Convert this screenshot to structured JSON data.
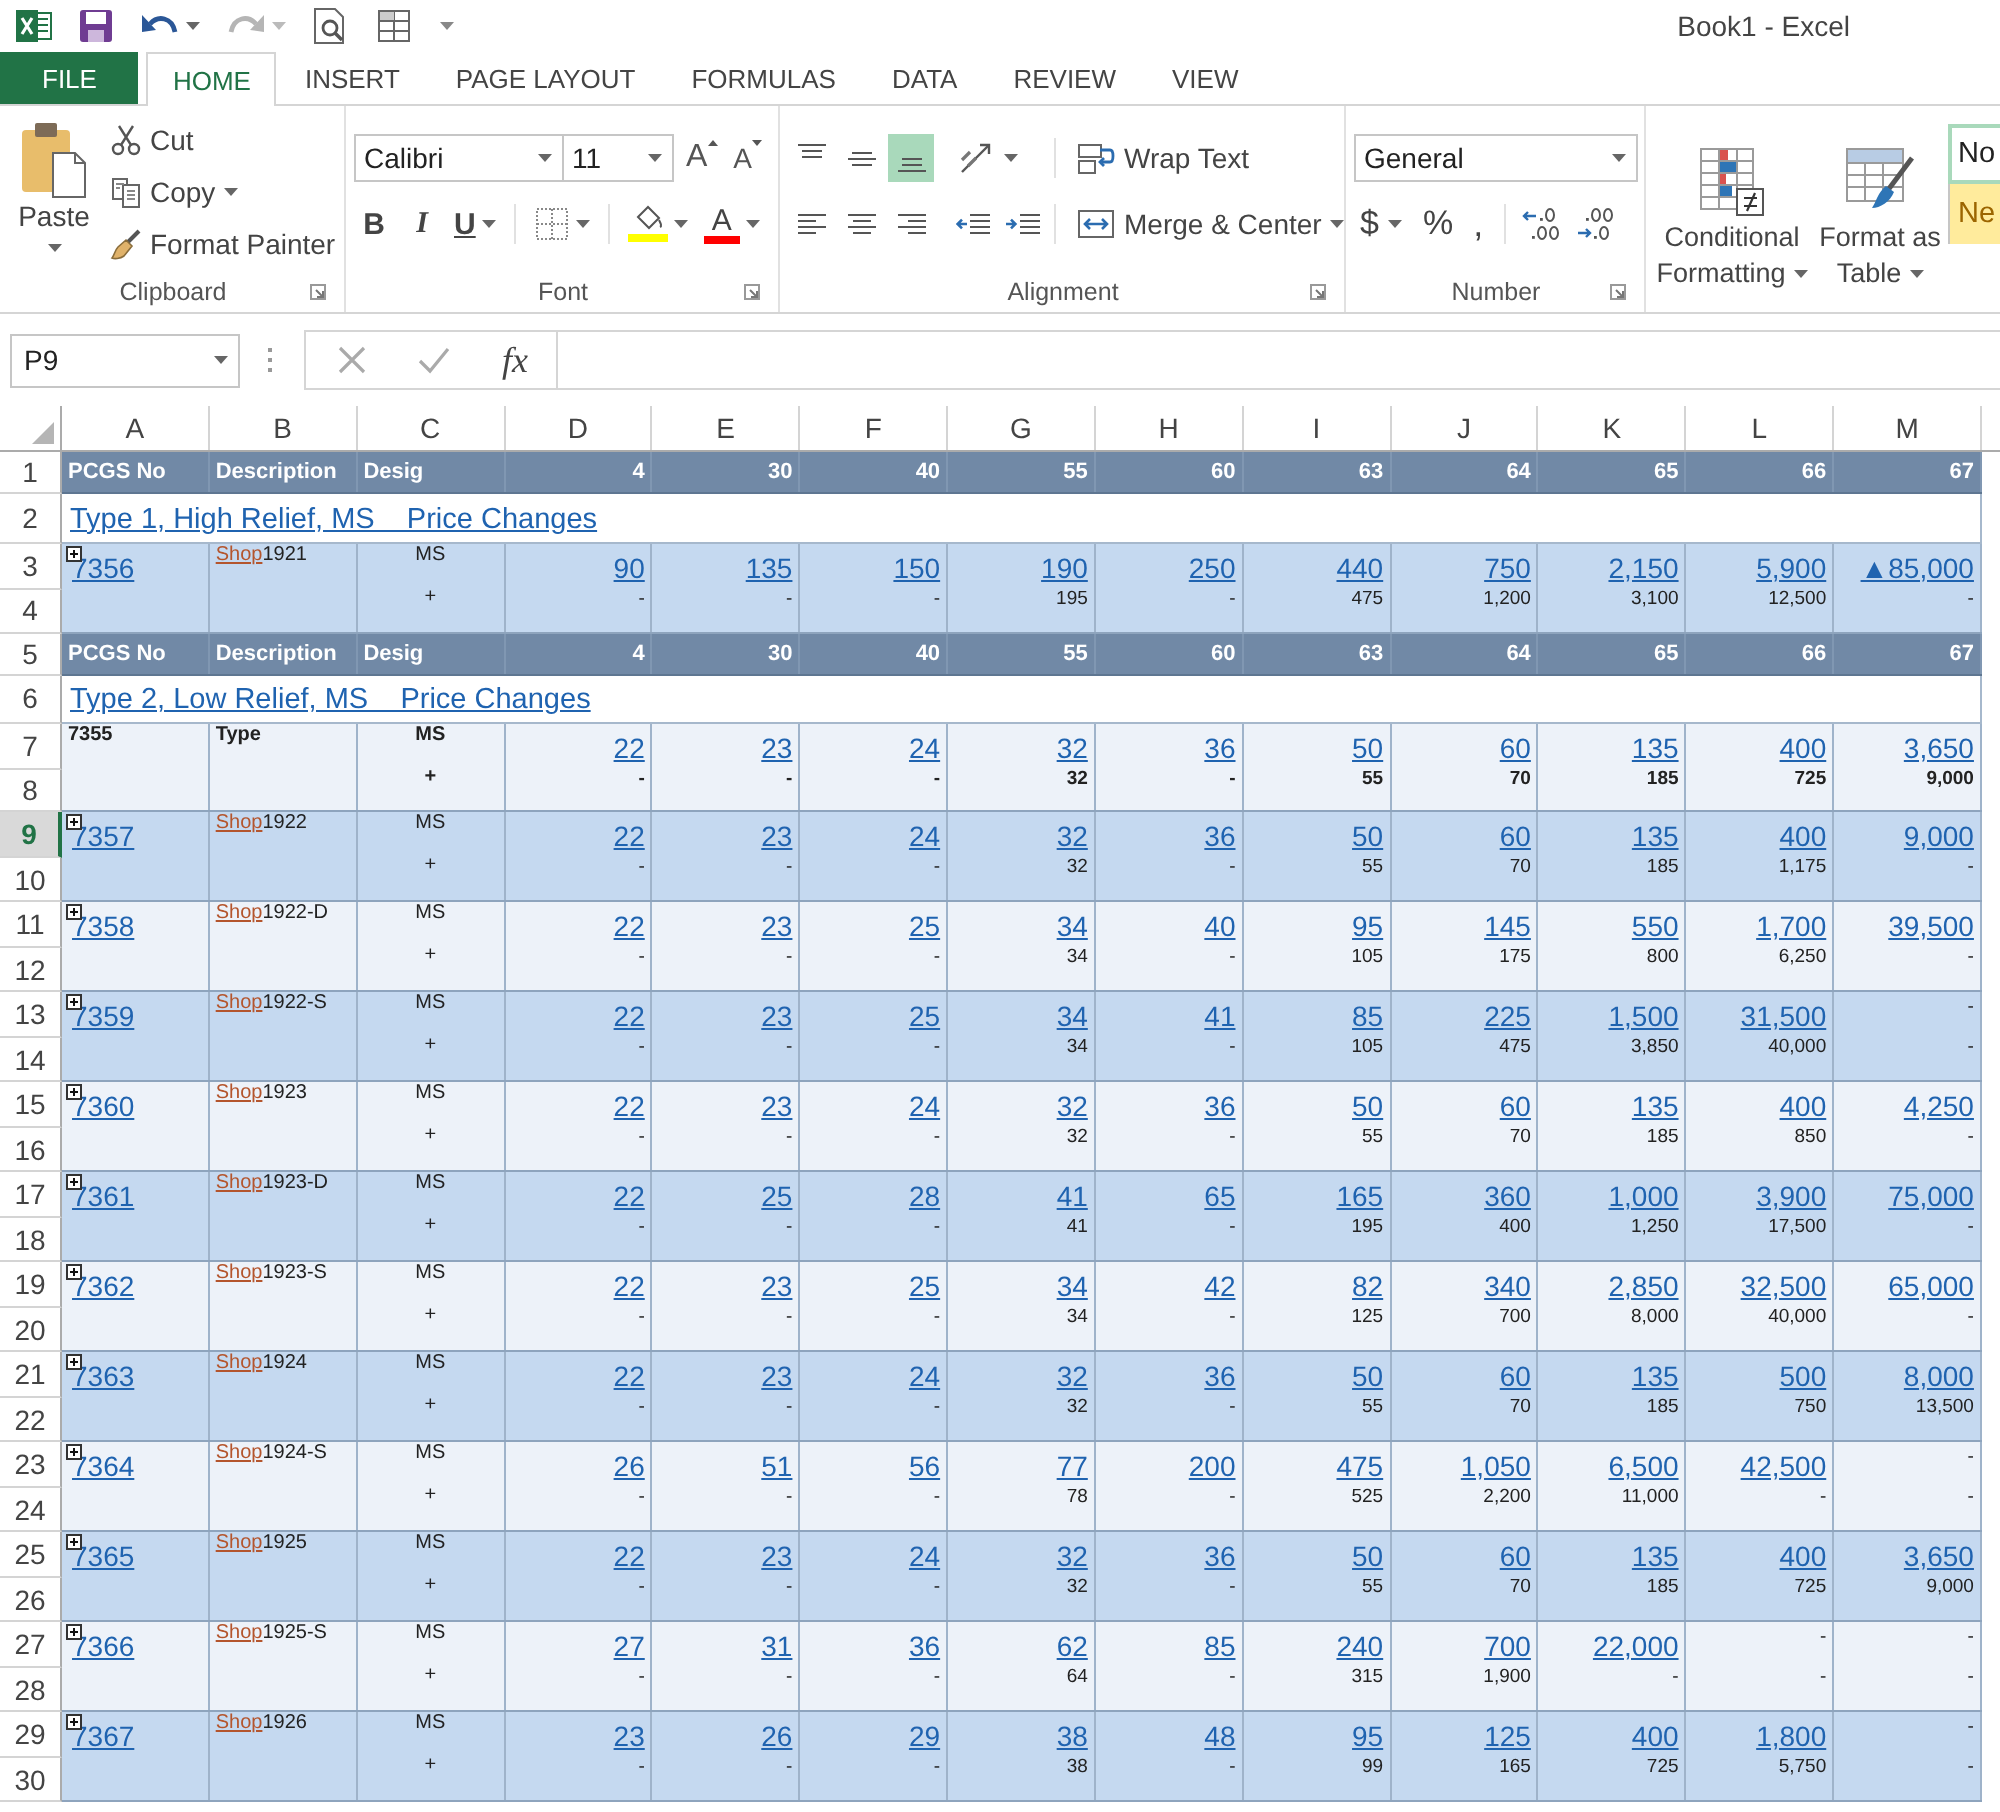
{
  "window": {
    "title": "Book1 - Excel"
  },
  "tabs": [
    {
      "label": "FILE",
      "kind": "file",
      "selected": false
    },
    {
      "label": "HOME",
      "kind": "tab",
      "selected": true
    },
    {
      "label": "INSERT",
      "kind": "tab",
      "selected": false
    },
    {
      "label": "PAGE LAYOUT",
      "kind": "tab",
      "selected": false
    },
    {
      "label": "FORMULAS",
      "kind": "tab",
      "selected": false
    },
    {
      "label": "DATA",
      "kind": "tab",
      "selected": false
    },
    {
      "label": "REVIEW",
      "kind": "tab",
      "selected": false
    },
    {
      "label": "VIEW",
      "kind": "tab",
      "selected": false
    }
  ],
  "ribbon": {
    "clipboard": {
      "label": "Clipboard",
      "paste": "Paste",
      "cut": "Cut",
      "copy": "Copy",
      "format_painter": "Format Painter"
    },
    "font": {
      "label": "Font",
      "name": "Calibri",
      "size": "11",
      "grow": "A",
      "shrink": "A",
      "bold": "B",
      "italic": "I",
      "underline": "U",
      "font_color": "A"
    },
    "alignment": {
      "label": "Alignment",
      "vertical": [
        {
          "kind": "top",
          "selected": false
        },
        {
          "kind": "middle",
          "selected": false
        },
        {
          "kind": "bottom",
          "selected": true
        }
      ],
      "horizontal": [
        {
          "kind": "left",
          "selected": false
        },
        {
          "kind": "center",
          "selected": false
        },
        {
          "kind": "right",
          "selected": false
        }
      ],
      "wrap_text": "Wrap Text",
      "merge_center": "Merge & Center"
    },
    "number": {
      "label": "Number",
      "format": "General",
      "currency": "$",
      "percent": "%",
      "comma": ","
    },
    "styles": {
      "conditional_formatting": "Conditional Formatting",
      "format_as_table": "Format as Table",
      "gallery": [
        {
          "label": "No",
          "kind": "normal"
        },
        {
          "label": "Ne",
          "kind": "neutral"
        }
      ]
    }
  },
  "formula_bar": {
    "name_box": "P9",
    "function_label": "fx"
  },
  "sheet": {
    "columns": [
      "A",
      "B",
      "C",
      "D",
      "E",
      "F",
      "G",
      "H",
      "I",
      "J",
      "K",
      "L",
      "M"
    ],
    "rows": [
      {
        "kind": "header",
        "row_numbers": [
          {
            "label": "1",
            "selected": false
          }
        ],
        "cells": [
          "PCGS No",
          "Description",
          "Desig",
          "4",
          "30",
          "40",
          "55",
          "60",
          "63",
          "64",
          "65",
          "66",
          "67"
        ]
      },
      {
        "kind": "title",
        "row_numbers": [
          {
            "label": "2",
            "selected": false
          }
        ],
        "text": "Type 1, High Relief, MS    Price Changes"
      },
      {
        "kind": "coin",
        "row_numbers": [
          {
            "label": "3",
            "selected": false
          },
          {
            "label": "4",
            "selected": false
          }
        ],
        "pcgs_no": "7356",
        "shop": "Shop",
        "description": "1921",
        "desig": "MS",
        "plus": "+",
        "cells": [
          {
            "kind": "link",
            "price": "90",
            "plus": "-"
          },
          {
            "kind": "link",
            "price": "135",
            "plus": "-"
          },
          {
            "kind": "link",
            "price": "150",
            "plus": "-"
          },
          {
            "kind": "link",
            "price": "190",
            "plus": "195"
          },
          {
            "kind": "link",
            "price": "250",
            "plus": "-"
          },
          {
            "kind": "link",
            "price": "440",
            "plus": "475"
          },
          {
            "kind": "link",
            "price": "750",
            "plus": "1,200"
          },
          {
            "kind": "link",
            "price": "2,150",
            "plus": "3,100"
          },
          {
            "kind": "link",
            "price": "5,900",
            "plus": "12,500"
          },
          {
            "kind": "link",
            "price": "▲85,000",
            "plus": "-"
          }
        ]
      },
      {
        "kind": "header",
        "row_numbers": [
          {
            "label": "5",
            "selected": false
          }
        ],
        "cells": [
          "PCGS No",
          "Description",
          "Desig",
          "4",
          "30",
          "40",
          "55",
          "60",
          "63",
          "64",
          "65",
          "66",
          "67"
        ]
      },
      {
        "kind": "title",
        "row_numbers": [
          {
            "label": "6",
            "selected": false
          }
        ],
        "text": "Type 2, Low Relief, MS    Price Changes"
      },
      {
        "kind": "summary",
        "row_numbers": [
          {
            "label": "7",
            "selected": false
          },
          {
            "label": "8",
            "selected": false
          }
        ],
        "pcgs_no": "7355",
        "description": "Type",
        "desig": "MS",
        "plus": "+",
        "cells": [
          {
            "kind": "link",
            "price": "22",
            "plus": "-"
          },
          {
            "kind": "link",
            "price": "23",
            "plus": "-"
          },
          {
            "kind": "link",
            "price": "24",
            "plus": "-"
          },
          {
            "kind": "link",
            "price": "32",
            "plus": "32"
          },
          {
            "kind": "link",
            "price": "36",
            "plus": "-"
          },
          {
            "kind": "link",
            "price": "50",
            "plus": "55"
          },
          {
            "kind": "link",
            "price": "60",
            "plus": "70"
          },
          {
            "kind": "link",
            "price": "135",
            "plus": "185"
          },
          {
            "kind": "link",
            "price": "400",
            "plus": "725"
          },
          {
            "kind": "link",
            "price": "3,650",
            "plus": "9,000"
          }
        ]
      },
      {
        "kind": "coin",
        "row_numbers": [
          {
            "label": "9",
            "selected": true
          },
          {
            "label": "10",
            "selected": false
          }
        ],
        "pcgs_no": "7357",
        "shop": "Shop",
        "description": "1922",
        "desig": "MS",
        "plus": "+",
        "cells": [
          {
            "kind": "link",
            "price": "22",
            "plus": "-"
          },
          {
            "kind": "link",
            "price": "23",
            "plus": "-"
          },
          {
            "kind": "link",
            "price": "24",
            "plus": "-"
          },
          {
            "kind": "link",
            "price": "32",
            "plus": "32"
          },
          {
            "kind": "link",
            "price": "36",
            "plus": "-"
          },
          {
            "kind": "link",
            "price": "50",
            "plus": "55"
          },
          {
            "kind": "link",
            "price": "60",
            "plus": "70"
          },
          {
            "kind": "link",
            "price": "135",
            "plus": "185"
          },
          {
            "kind": "link",
            "price": "400",
            "plus": "1,175"
          },
          {
            "kind": "link",
            "price": "9,000",
            "plus": "-"
          }
        ]
      },
      {
        "kind": "coin",
        "row_numbers": [
          {
            "label": "11",
            "selected": false
          },
          {
            "label": "12",
            "selected": false
          }
        ],
        "pcgs_no": "7358",
        "shop": "Shop",
        "description": "1922-D",
        "desig": "MS",
        "plus": "+",
        "cells": [
          {
            "kind": "link",
            "price": "22",
            "plus": "-"
          },
          {
            "kind": "link",
            "price": "23",
            "plus": "-"
          },
          {
            "kind": "link",
            "price": "25",
            "plus": "-"
          },
          {
            "kind": "link",
            "price": "34",
            "plus": "34"
          },
          {
            "kind": "link",
            "price": "40",
            "plus": "-"
          },
          {
            "kind": "link",
            "price": "95",
            "plus": "105"
          },
          {
            "kind": "link",
            "price": "145",
            "plus": "175"
          },
          {
            "kind": "link",
            "price": "550",
            "plus": "800"
          },
          {
            "kind": "link",
            "price": "1,700",
            "plus": "6,250"
          },
          {
            "kind": "link",
            "price": "39,500",
            "plus": "-"
          }
        ]
      },
      {
        "kind": "coin",
        "row_numbers": [
          {
            "label": "13",
            "selected": false
          },
          {
            "label": "14",
            "selected": false
          }
        ],
        "pcgs_no": "7359",
        "shop": "Shop",
        "description": "1922-S",
        "desig": "MS",
        "plus": "+",
        "cells": [
          {
            "kind": "link",
            "price": "22",
            "plus": "-"
          },
          {
            "kind": "link",
            "price": "23",
            "plus": "-"
          },
          {
            "kind": "link",
            "price": "25",
            "plus": "-"
          },
          {
            "kind": "link",
            "price": "34",
            "plus": "34"
          },
          {
            "kind": "link",
            "price": "41",
            "plus": "-"
          },
          {
            "kind": "link",
            "price": "85",
            "plus": "105"
          },
          {
            "kind": "link",
            "price": "225",
            "plus": "475"
          },
          {
            "kind": "link",
            "price": "1,500",
            "plus": "3,850"
          },
          {
            "kind": "link",
            "price": "31,500",
            "plus": "40,000"
          },
          {
            "kind": "plain",
            "price": "-",
            "plus": "-"
          }
        ]
      },
      {
        "kind": "coin",
        "row_numbers": [
          {
            "label": "15",
            "selected": false
          },
          {
            "label": "16",
            "selected": false
          }
        ],
        "pcgs_no": "7360",
        "shop": "Shop",
        "description": "1923",
        "desig": "MS",
        "plus": "+",
        "cells": [
          {
            "kind": "link",
            "price": "22",
            "plus": "-"
          },
          {
            "kind": "link",
            "price": "23",
            "plus": "-"
          },
          {
            "kind": "link",
            "price": "24",
            "plus": "-"
          },
          {
            "kind": "link",
            "price": "32",
            "plus": "32"
          },
          {
            "kind": "link",
            "price": "36",
            "plus": "-"
          },
          {
            "kind": "link",
            "price": "50",
            "plus": "55"
          },
          {
            "kind": "link",
            "price": "60",
            "plus": "70"
          },
          {
            "kind": "link",
            "price": "135",
            "plus": "185"
          },
          {
            "kind": "link",
            "price": "400",
            "plus": "850"
          },
          {
            "kind": "link",
            "price": "4,250",
            "plus": "-"
          }
        ]
      },
      {
        "kind": "coin",
        "row_numbers": [
          {
            "label": "17",
            "selected": false
          },
          {
            "label": "18",
            "selected": false
          }
        ],
        "pcgs_no": "7361",
        "shop": "Shop",
        "description": "1923-D",
        "desig": "MS",
        "plus": "+",
        "cells": [
          {
            "kind": "link",
            "price": "22",
            "plus": "-"
          },
          {
            "kind": "link",
            "price": "25",
            "plus": "-"
          },
          {
            "kind": "link",
            "price": "28",
            "plus": "-"
          },
          {
            "kind": "link",
            "price": "41",
            "plus": "41"
          },
          {
            "kind": "link",
            "price": "65",
            "plus": "-"
          },
          {
            "kind": "link",
            "price": "165",
            "plus": "195"
          },
          {
            "kind": "link",
            "price": "360",
            "plus": "400"
          },
          {
            "kind": "link",
            "price": "1,000",
            "plus": "1,250"
          },
          {
            "kind": "link",
            "price": "3,900",
            "plus": "17,500"
          },
          {
            "kind": "link",
            "price": "75,000",
            "plus": "-"
          }
        ]
      },
      {
        "kind": "coin",
        "row_numbers": [
          {
            "label": "19",
            "selected": false
          },
          {
            "label": "20",
            "selected": false
          }
        ],
        "pcgs_no": "7362",
        "shop": "Shop",
        "description": "1923-S",
        "desig": "MS",
        "plus": "+",
        "cells": [
          {
            "kind": "link",
            "price": "22",
            "plus": "-"
          },
          {
            "kind": "link",
            "price": "23",
            "plus": "-"
          },
          {
            "kind": "link",
            "price": "25",
            "plus": "-"
          },
          {
            "kind": "link",
            "price": "34",
            "plus": "34"
          },
          {
            "kind": "link",
            "price": "42",
            "plus": "-"
          },
          {
            "kind": "link",
            "price": "82",
            "plus": "125"
          },
          {
            "kind": "link",
            "price": "340",
            "plus": "700"
          },
          {
            "kind": "link",
            "price": "2,850",
            "plus": "8,000"
          },
          {
            "kind": "link",
            "price": "32,500",
            "plus": "40,000"
          },
          {
            "kind": "link",
            "price": "65,000",
            "plus": "-"
          }
        ]
      },
      {
        "kind": "coin",
        "row_numbers": [
          {
            "label": "21",
            "selected": false
          },
          {
            "label": "22",
            "selected": false
          }
        ],
        "pcgs_no": "7363",
        "shop": "Shop",
        "description": "1924",
        "desig": "MS",
        "plus": "+",
        "cells": [
          {
            "kind": "link",
            "price": "22",
            "plus": "-"
          },
          {
            "kind": "link",
            "price": "23",
            "plus": "-"
          },
          {
            "kind": "link",
            "price": "24",
            "plus": "-"
          },
          {
            "kind": "link",
            "price": "32",
            "plus": "32"
          },
          {
            "kind": "link",
            "price": "36",
            "plus": "-"
          },
          {
            "kind": "link",
            "price": "50",
            "plus": "55"
          },
          {
            "kind": "link",
            "price": "60",
            "plus": "70"
          },
          {
            "kind": "link",
            "price": "135",
            "plus": "185"
          },
          {
            "kind": "link",
            "price": "500",
            "plus": "750"
          },
          {
            "kind": "link",
            "price": "8,000",
            "plus": "13,500"
          }
        ]
      },
      {
        "kind": "coin",
        "row_numbers": [
          {
            "label": "23",
            "selected": false
          },
          {
            "label": "24",
            "selected": false
          }
        ],
        "pcgs_no": "7364",
        "shop": "Shop",
        "description": "1924-S",
        "desig": "MS",
        "plus": "+",
        "cells": [
          {
            "kind": "link",
            "price": "26",
            "plus": "-"
          },
          {
            "kind": "link",
            "price": "51",
            "plus": "-"
          },
          {
            "kind": "link",
            "price": "56",
            "plus": "-"
          },
          {
            "kind": "link",
            "price": "77",
            "plus": "78"
          },
          {
            "kind": "link",
            "price": "200",
            "plus": "-"
          },
          {
            "kind": "link",
            "price": "475",
            "plus": "525"
          },
          {
            "kind": "link",
            "price": "1,050",
            "plus": "2,200"
          },
          {
            "kind": "link",
            "price": "6,500",
            "plus": "11,000"
          },
          {
            "kind": "link",
            "price": "42,500",
            "plus": "-"
          },
          {
            "kind": "plain",
            "price": "-",
            "plus": "-"
          }
        ]
      },
      {
        "kind": "coin",
        "row_numbers": [
          {
            "label": "25",
            "selected": false
          },
          {
            "label": "26",
            "selected": false
          }
        ],
        "pcgs_no": "7365",
        "shop": "Shop",
        "description": "1925",
        "desig": "MS",
        "plus": "+",
        "cells": [
          {
            "kind": "link",
            "price": "22",
            "plus": "-"
          },
          {
            "kind": "link",
            "price": "23",
            "plus": "-"
          },
          {
            "kind": "link",
            "price": "24",
            "plus": "-"
          },
          {
            "kind": "link",
            "price": "32",
            "plus": "32"
          },
          {
            "kind": "link",
            "price": "36",
            "plus": "-"
          },
          {
            "kind": "link",
            "price": "50",
            "plus": "55"
          },
          {
            "kind": "link",
            "price": "60",
            "plus": "70"
          },
          {
            "kind": "link",
            "price": "135",
            "plus": "185"
          },
          {
            "kind": "link",
            "price": "400",
            "plus": "725"
          },
          {
            "kind": "link",
            "price": "3,650",
            "plus": "9,000"
          }
        ]
      },
      {
        "kind": "coin",
        "row_numbers": [
          {
            "label": "27",
            "selected": false
          },
          {
            "label": "28",
            "selected": false
          }
        ],
        "pcgs_no": "7366",
        "shop": "Shop",
        "description": "1925-S",
        "desig": "MS",
        "plus": "+",
        "cells": [
          {
            "kind": "link",
            "price": "27",
            "plus": "-"
          },
          {
            "kind": "link",
            "price": "31",
            "plus": "-"
          },
          {
            "kind": "link",
            "price": "36",
            "plus": "-"
          },
          {
            "kind": "link",
            "price": "62",
            "plus": "64"
          },
          {
            "kind": "link",
            "price": "85",
            "plus": "-"
          },
          {
            "kind": "link",
            "price": "240",
            "plus": "315"
          },
          {
            "kind": "link",
            "price": "700",
            "plus": "1,900"
          },
          {
            "kind": "link",
            "price": "22,000",
            "plus": "-"
          },
          {
            "kind": "plain",
            "price": "-",
            "plus": "-"
          },
          {
            "kind": "plain",
            "price": "-",
            "plus": "-"
          }
        ]
      },
      {
        "kind": "coin",
        "row_numbers": [
          {
            "label": "29",
            "selected": false
          },
          {
            "label": "30",
            "selected": false
          }
        ],
        "pcgs_no": "7367",
        "shop": "Shop",
        "description": "1926",
        "desig": "MS",
        "plus": "+",
        "cells": [
          {
            "kind": "link",
            "price": "23",
            "plus": "-"
          },
          {
            "kind": "link",
            "price": "26",
            "plus": "-"
          },
          {
            "kind": "link",
            "price": "29",
            "plus": "-"
          },
          {
            "kind": "link",
            "price": "38",
            "plus": "38"
          },
          {
            "kind": "link",
            "price": "48",
            "plus": "-"
          },
          {
            "kind": "link",
            "price": "95",
            "plus": "99"
          },
          {
            "kind": "link",
            "price": "125",
            "plus": "165"
          },
          {
            "kind": "link",
            "price": "400",
            "plus": "725"
          },
          {
            "kind": "link",
            "price": "1,800",
            "plus": "5,750"
          },
          {
            "kind": "plain",
            "price": "-",
            "plus": "-"
          }
        ]
      }
    ]
  }
}
